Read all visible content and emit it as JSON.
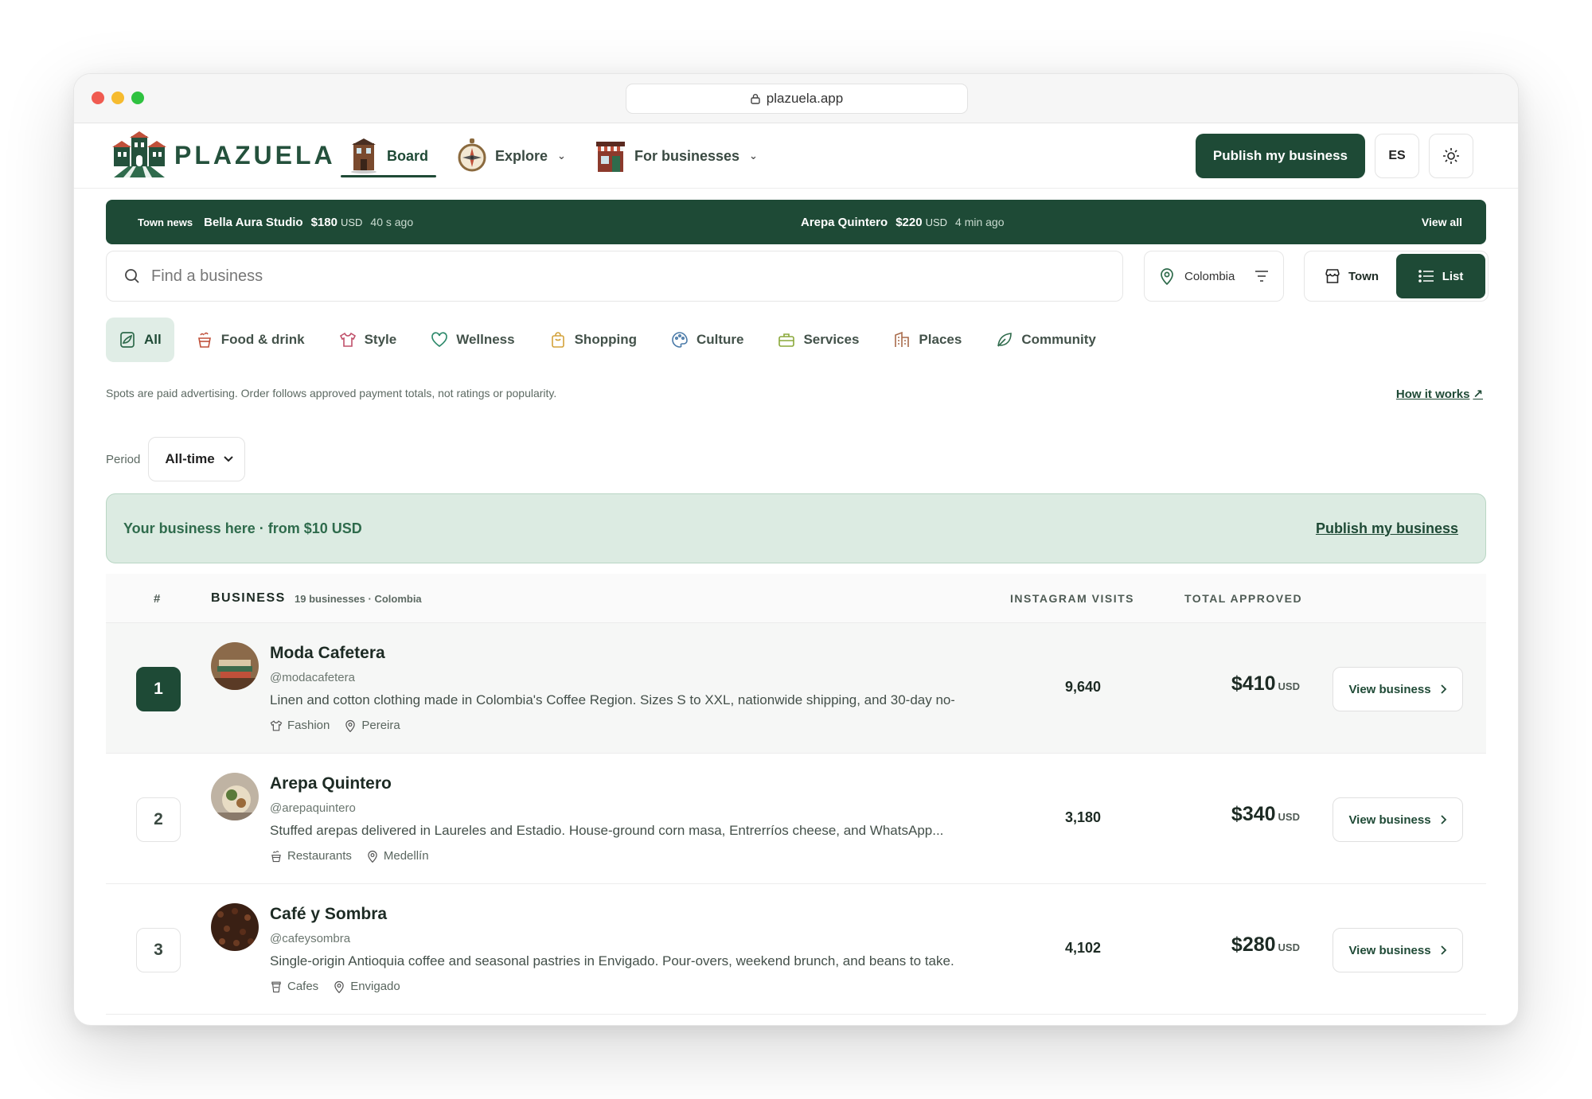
{
  "browser": {
    "url": "plazuela.app"
  },
  "brand": {
    "name": "PLAZUELA"
  },
  "nav": {
    "board": "Board",
    "explore": "Explore",
    "for_businesses": "For businesses"
  },
  "header": {
    "publish": "Publish my business",
    "lang": "ES"
  },
  "ticker": {
    "label": "Town news",
    "items": [
      {
        "name": "Bella Aura Studio",
        "amount": "$180",
        "currency": "USD",
        "ago": "40 s ago"
      },
      {
        "name": "Arepa Quintero",
        "amount": "$220",
        "currency": "USD",
        "ago": "4 min ago"
      }
    ],
    "view_all": "View all"
  },
  "search": {
    "placeholder": "Find a business"
  },
  "filter": {
    "country": "Colombia"
  },
  "view_toggle": {
    "town": "Town",
    "list": "List"
  },
  "categories": [
    {
      "label": "All",
      "icon": "all-icon"
    },
    {
      "label": "Food & drink",
      "icon": "food-icon"
    },
    {
      "label": "Style",
      "icon": "shirt-icon"
    },
    {
      "label": "Wellness",
      "icon": "heart-icon"
    },
    {
      "label": "Shopping",
      "icon": "bag-icon"
    },
    {
      "label": "Culture",
      "icon": "palette-icon"
    },
    {
      "label": "Services",
      "icon": "briefcase-icon"
    },
    {
      "label": "Places",
      "icon": "building-icon"
    },
    {
      "label": "Community",
      "icon": "leaf-icon"
    }
  ],
  "disclaimer": "Spots are paid advertising. Order follows approved payment totals, not ratings or popularity.",
  "how_it_works": "How it works",
  "period": {
    "label": "Period",
    "value": "All-time"
  },
  "promo": {
    "text": "Your business here · from $10 USD",
    "link": "Publish my business"
  },
  "table": {
    "col_rank": "#",
    "col_business": "BUSINESS",
    "count": "19 businesses · Colombia",
    "col_visits": "INSTAGRAM VISITS",
    "col_total": "TOTAL APPROVED",
    "view_label": "View business",
    "rows": [
      {
        "rank": "1",
        "name": "Moda Cafetera",
        "handle": "@modacafetera",
        "desc": "Linen and cotton clothing made in Colombia's Coffee Region. Sizes S to XXL, nationwide shipping, and 30-day no-...",
        "category": "Fashion",
        "city": "Pereira",
        "visits": "9,640",
        "total": "$410",
        "currency": "USD"
      },
      {
        "rank": "2",
        "name": "Arepa Quintero",
        "handle": "@arepaquintero",
        "desc": "Stuffed arepas delivered in Laureles and Estadio. House-ground corn masa, Entrerríos cheese, and WhatsApp...",
        "category": "Restaurants",
        "city": "Medellín",
        "visits": "3,180",
        "total": "$340",
        "currency": "USD"
      },
      {
        "rank": "3",
        "name": "Café y Sombra",
        "handle": "@cafeysombra",
        "desc": "Single-origin Antioquia coffee and seasonal pastries in Envigado. Pour-overs, weekend brunch, and beans to take...",
        "category": "Cafes",
        "city": "Envigado",
        "visits": "4,102",
        "total": "$280",
        "currency": "USD"
      }
    ]
  },
  "colors": {
    "brand_green": "#1e4a36",
    "promo_bg": "#dcebe2"
  }
}
